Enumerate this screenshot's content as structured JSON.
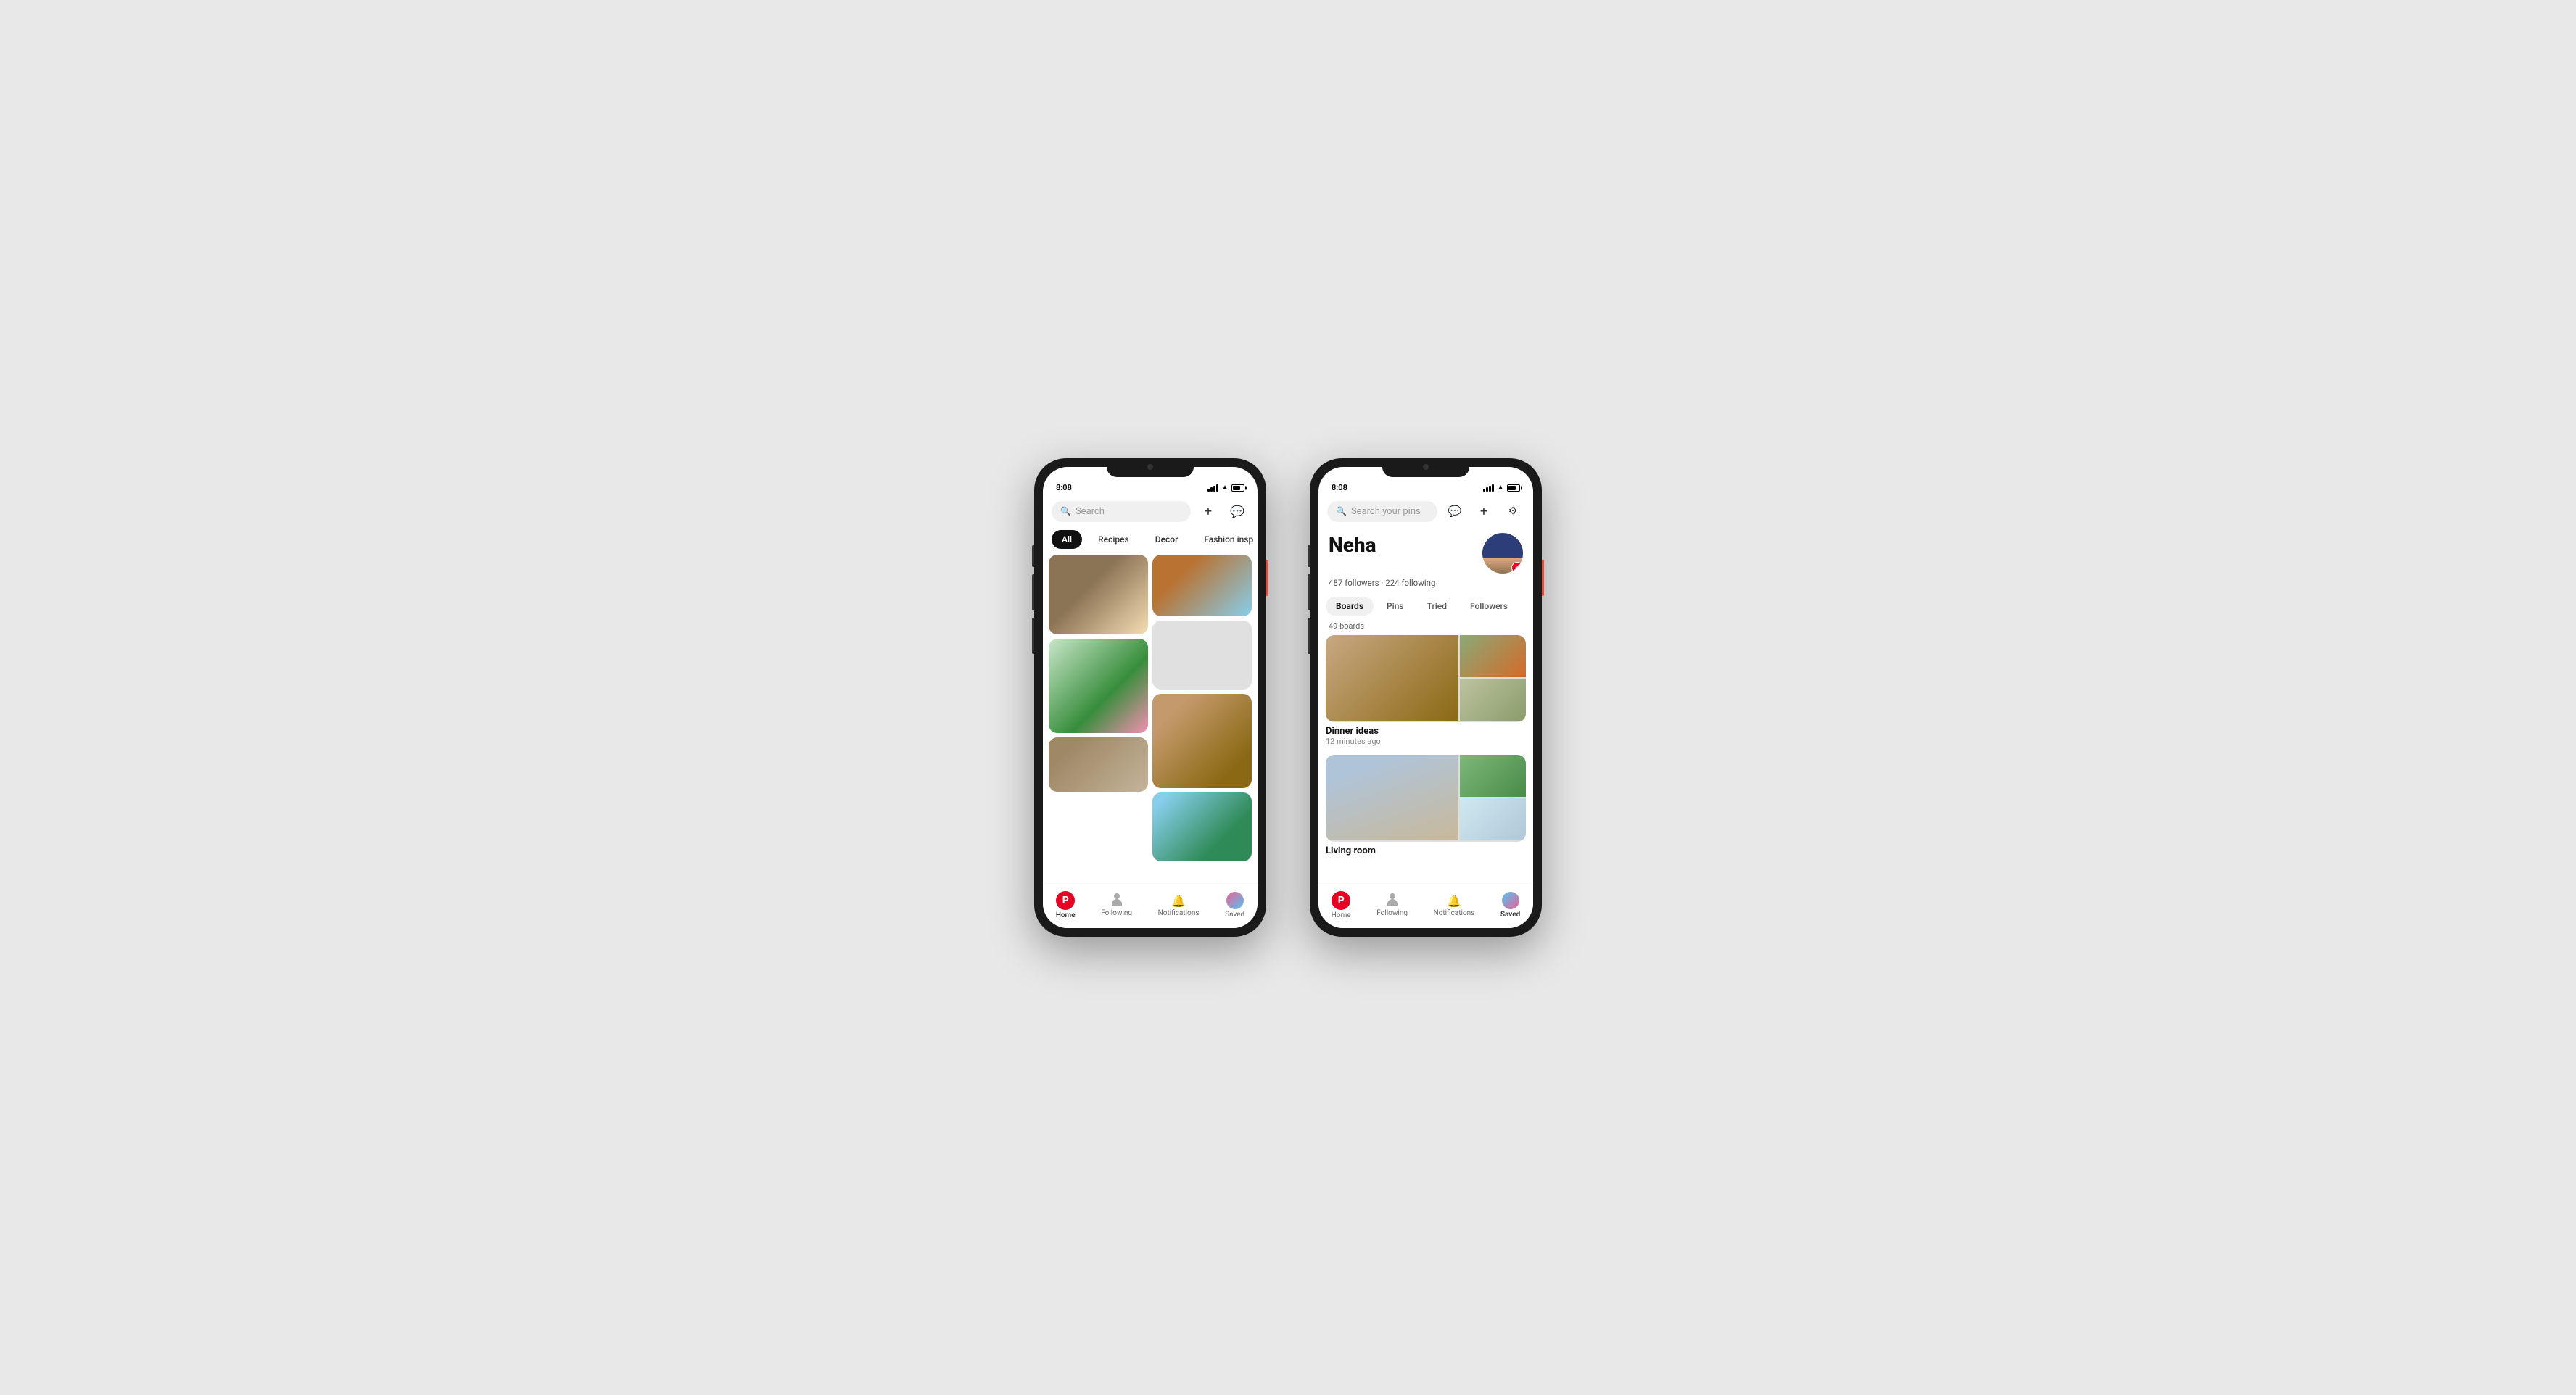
{
  "phone1": {
    "status_time": "8:08",
    "search_placeholder": "Search",
    "categories": [
      "All",
      "Recipes",
      "Decor",
      "Fashion insp"
    ],
    "active_category": "All",
    "bottom_nav": [
      {
        "id": "home",
        "label": "Home",
        "active": true
      },
      {
        "id": "following",
        "label": "Following",
        "active": false
      },
      {
        "id": "notifications",
        "label": "Notifications",
        "active": false
      },
      {
        "id": "saved",
        "label": "Saved",
        "active": false
      }
    ],
    "add_icon": "+",
    "message_icon": "💬"
  },
  "phone2": {
    "status_time": "8:08",
    "search_placeholder": "Search your pins",
    "profile_name": "Neha",
    "followers_count": "487 followers",
    "following_count": "224 following",
    "profile_tabs": [
      "Boards",
      "Pins",
      "Tried",
      "Followers"
    ],
    "active_tab": "Boards",
    "boards_count": "49 boards",
    "board1_title": "Dinner ideas",
    "board1_time": "12 minutes ago",
    "board2_title": "Living room",
    "bottom_nav": [
      {
        "id": "home",
        "label": "Home",
        "active": false
      },
      {
        "id": "following",
        "label": "Following",
        "active": false
      },
      {
        "id": "notifications",
        "label": "Notifications",
        "active": false
      },
      {
        "id": "saved",
        "label": "Saved",
        "active": true
      }
    ],
    "message_icon": "💬",
    "add_icon": "+",
    "settings_icon": "⚙"
  }
}
